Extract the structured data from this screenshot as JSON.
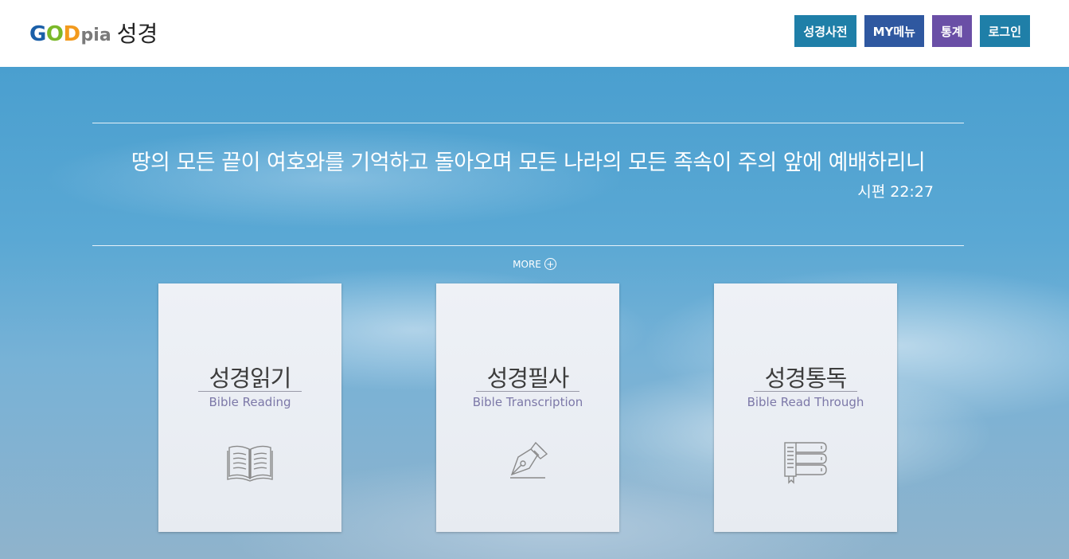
{
  "brand": {
    "g": "G",
    "o": "O",
    "d": "D",
    "pia": "pia",
    "suffix": "성경"
  },
  "nav": [
    {
      "label": "성경사전",
      "color": "#1f7fa8"
    },
    {
      "label": "MY메뉴",
      "color": "#2f58a0"
    },
    {
      "label": "통계",
      "color": "#6a4fa6"
    },
    {
      "label": "로그인",
      "color": "#1f7fa8"
    }
  ],
  "verse": {
    "text": "땅의 모든 끝이 여호와를 기억하고 돌아오며 모든 나라의 모든 족속이 주의 앞에 예배하리니",
    "reference": "시편 22:27"
  },
  "more": {
    "label": "MORE",
    "icon": "plus-circle-icon"
  },
  "cards": [
    {
      "title": "성경읽기",
      "subtitle": "Bible Reading",
      "icon": "open-book-icon"
    },
    {
      "title": "성경필사",
      "subtitle": "Bible Transcription",
      "icon": "fountain-pen-icon"
    },
    {
      "title": "성경통독",
      "subtitle": "Bible Read Through",
      "icon": "stacked-books-icon"
    }
  ]
}
